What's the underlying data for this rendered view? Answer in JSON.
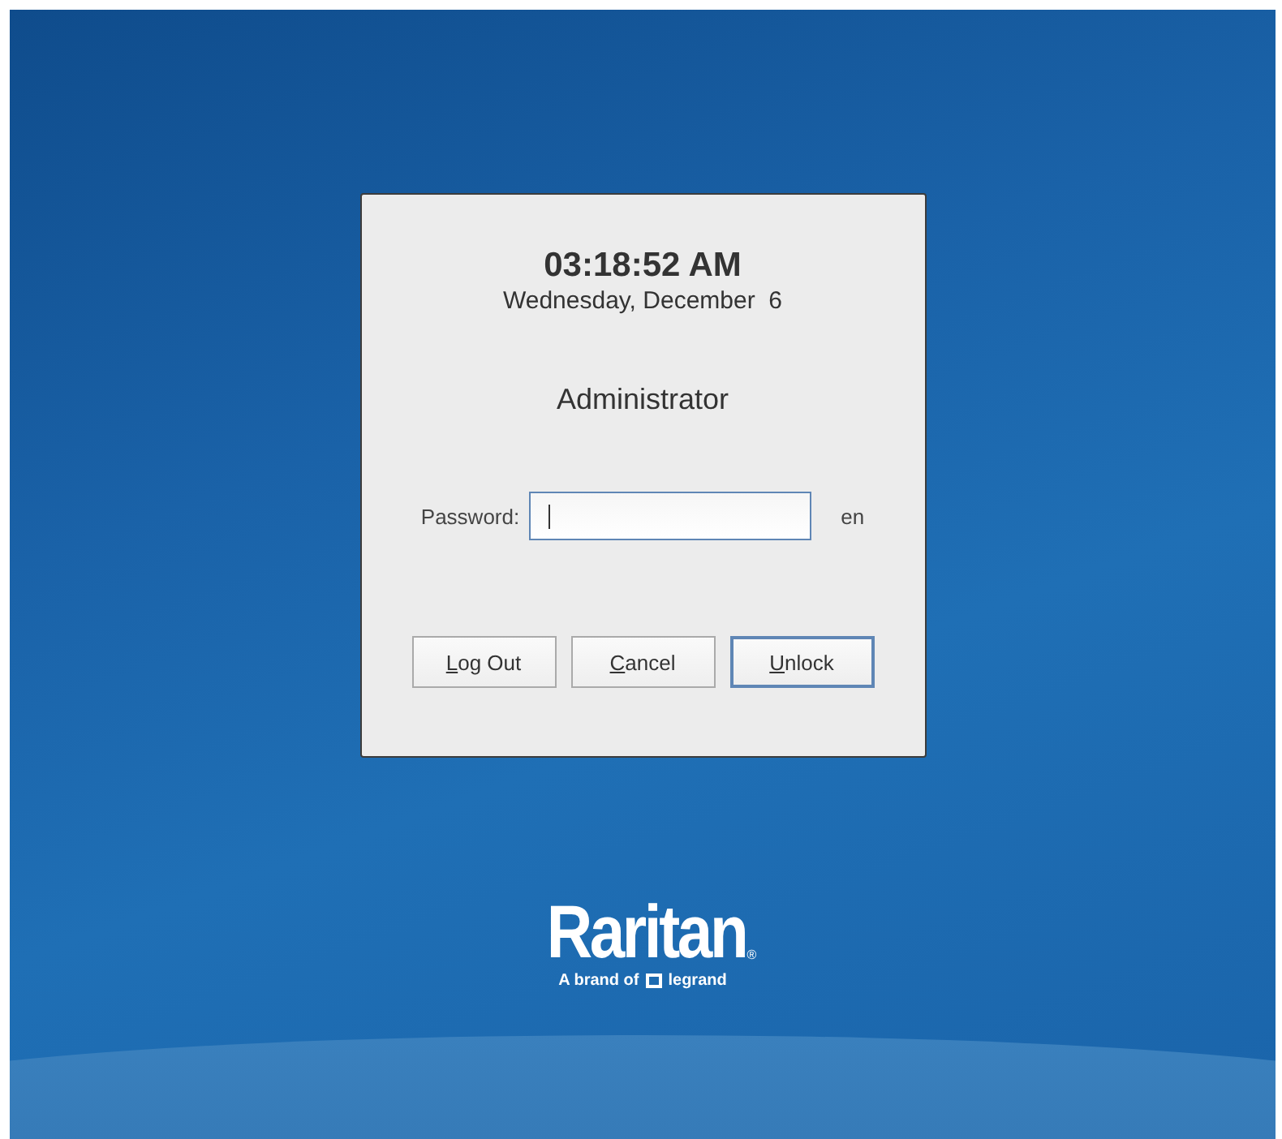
{
  "lock_dialog": {
    "time": "03:18:52 AM",
    "date": "Wednesday, December  6",
    "user": "Administrator",
    "password_label": "Password:",
    "keyboard_layout": "en",
    "buttons": [
      {
        "label": "Log Out",
        "default": false
      },
      {
        "label": "Cancel",
        "default": false
      },
      {
        "label": "Unlock",
        "default": true
      }
    ]
  },
  "logo": {
    "wordmark": "Raritan",
    "registered": "®",
    "tagline": "A brand of",
    "partner": "legrand"
  }
}
